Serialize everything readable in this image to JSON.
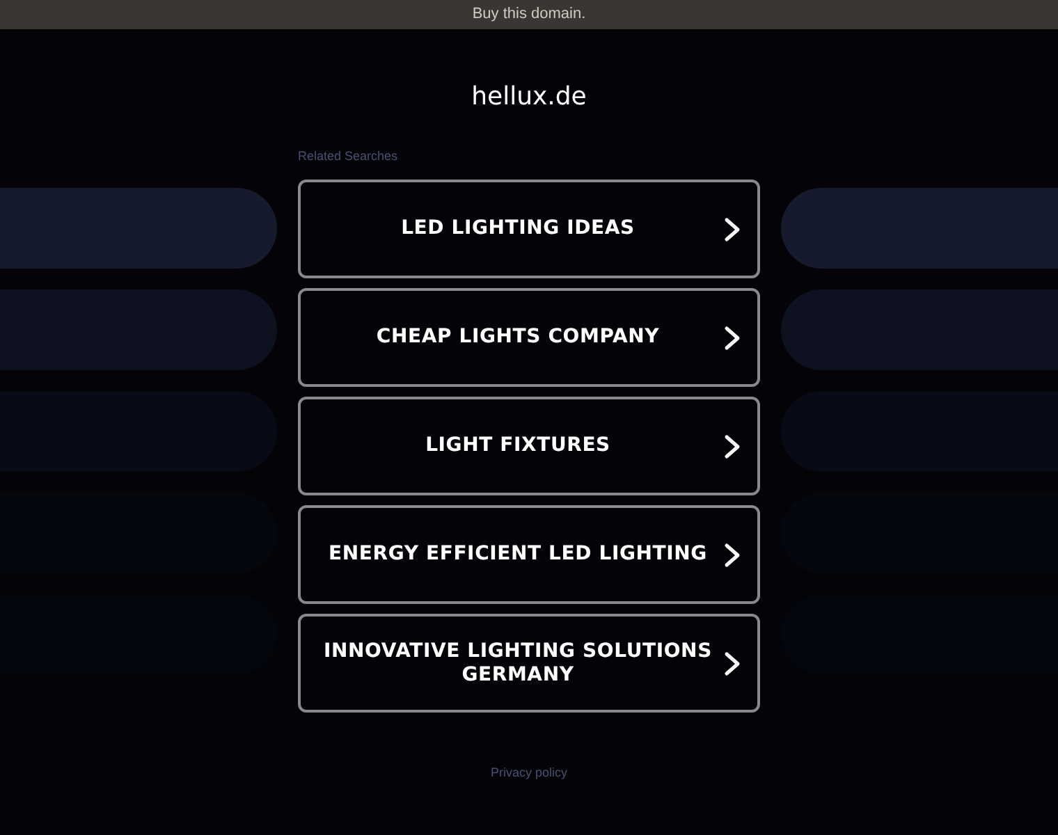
{
  "top_bar": {
    "link": "Buy this domain."
  },
  "site_title": "hellux.de",
  "related_heading": "Related Searches",
  "links": [
    {
      "label": "LED LIGHTING IDEAS"
    },
    {
      "label": "CHEAP LIGHTS COMPANY"
    },
    {
      "label": "LIGHT FIXTURES"
    },
    {
      "label": "ENERGY EFFICIENT LED LIGHTING"
    },
    {
      "label": "INNOVATIVE LIGHTING SOLUTIONS GERMANY"
    }
  ],
  "footer": {
    "link": "Privacy policy"
  }
}
